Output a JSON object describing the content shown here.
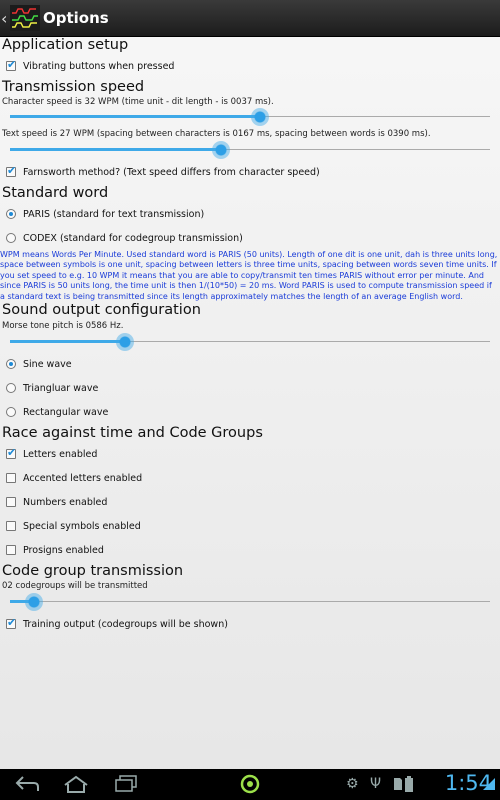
{
  "app": {
    "title": "Options",
    "logo_text": "/.-/--/../.-../.-.-"
  },
  "sections": {
    "app_setup": "Application setup",
    "transmission": "Transmission speed",
    "standard_word": "Standard word",
    "sound": "Sound output configuration",
    "race": "Race against time and Code Groups",
    "code_group": "Code group transmission"
  },
  "options": {
    "vibrating": {
      "label": "Vibrating buttons when pressed",
      "checked": true
    },
    "farnsworth": {
      "label": "Farnsworth method? (Text speed differs from character speed)",
      "checked": true
    },
    "training_output": {
      "label": "Training output (codegroups will be shown)",
      "checked": true
    }
  },
  "transmission": {
    "char_speed_text": "Character speed is 32 WPM (time unit - dit length - is 0037 ms).",
    "char_speed_level": 0.52,
    "text_speed_text": "Text speed is 27 WPM (spacing between characters is 0167 ms, spacing between words is 0390 ms).",
    "text_speed_level": 0.44
  },
  "standard_word": {
    "paris": "PARIS (standard for text transmission)",
    "codex": "CODEX (standard for codegroup transmission)",
    "selected": "paris"
  },
  "info_text": "WPM means Words Per Minute. Used standard word is PARIS (50 units). Length of one dit is one unit, dah is three units long, space between symbols is one unit, spacing between letters is three time units, spacing between words seven time units. If you set speed to e.g. 10 WPM it means that you are able to copy/transmit ten times PARIS without error per minute. And since PARIS is 50 units long, the time unit is then 1/(10*50) = 20 ms. Word PARIS is used to compute transmission speed if a standard text is being transmitted since its length approximately matches the length of an average English word.",
  "sound": {
    "pitch_text": "Morse tone pitch is 0586 Hz.",
    "pitch_level": 0.24,
    "waves": [
      "Sine wave",
      "Triangluar wave",
      "Rectangular wave"
    ],
    "selected_wave": 0
  },
  "race": {
    "items": [
      {
        "label": "Letters enabled",
        "checked": true
      },
      {
        "label": "Accented letters enabled",
        "checked": false
      },
      {
        "label": "Numbers enabled",
        "checked": false
      },
      {
        "label": "Special symbols enabled",
        "checked": false
      },
      {
        "label": "Prosigns enabled",
        "checked": false
      }
    ]
  },
  "code_group": {
    "count_text": "02 codegroups will be transmitted",
    "count_level": 0.05
  },
  "status": {
    "time": "1:54"
  },
  "colors": {
    "accent": "#3ea9e8",
    "info_text": "#1a3cd8",
    "actionbar": "#2a2a2a"
  },
  "icons": [
    "back-arrow-icon",
    "home-icon",
    "recent-apps-icon",
    "app-circle-icon",
    "android-debug-icon",
    "usb-icon",
    "sd-card-icon",
    "battery-icon"
  ]
}
